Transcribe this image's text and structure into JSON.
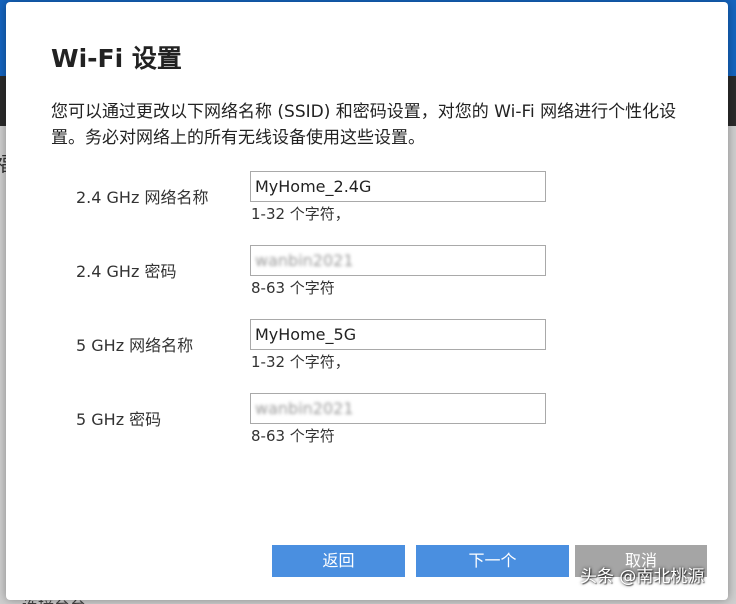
{
  "background": {
    "edge_char": "福",
    "bottom_text": "连接至至"
  },
  "modal": {
    "title": "Wi-Fi 设置",
    "description": "您可以通过更改以下网络名称 (SSID) 和密码设置，对您的 Wi-Fi 网络进行个性化设置。务必对网络上的所有无线设备使用这些设置。",
    "fields": [
      {
        "label": "2.4 GHz 网络名称",
        "value": "MyHome_2.4G",
        "hint": "1-32 个字符，"
      },
      {
        "label": "2.4 GHz 密码",
        "value": "wanbin2021",
        "hint": "8-63 个字符"
      },
      {
        "label": "5 GHz 网络名称",
        "value": "MyHome_5G",
        "hint": "1-32 个字符，"
      },
      {
        "label": "5 GHz 密码",
        "value": "wanbin2021",
        "hint": "8-63 个字符"
      }
    ],
    "buttons": {
      "back": "返回",
      "next": "下一个",
      "cancel": "取消"
    }
  },
  "watermark": "头条 @南北桃源",
  "colors": {
    "primary_button": "#4a8fe0",
    "cancel_button": "#a5a5a5",
    "header_blue": "#1565c0",
    "nav_dark": "#2b2b2b"
  }
}
